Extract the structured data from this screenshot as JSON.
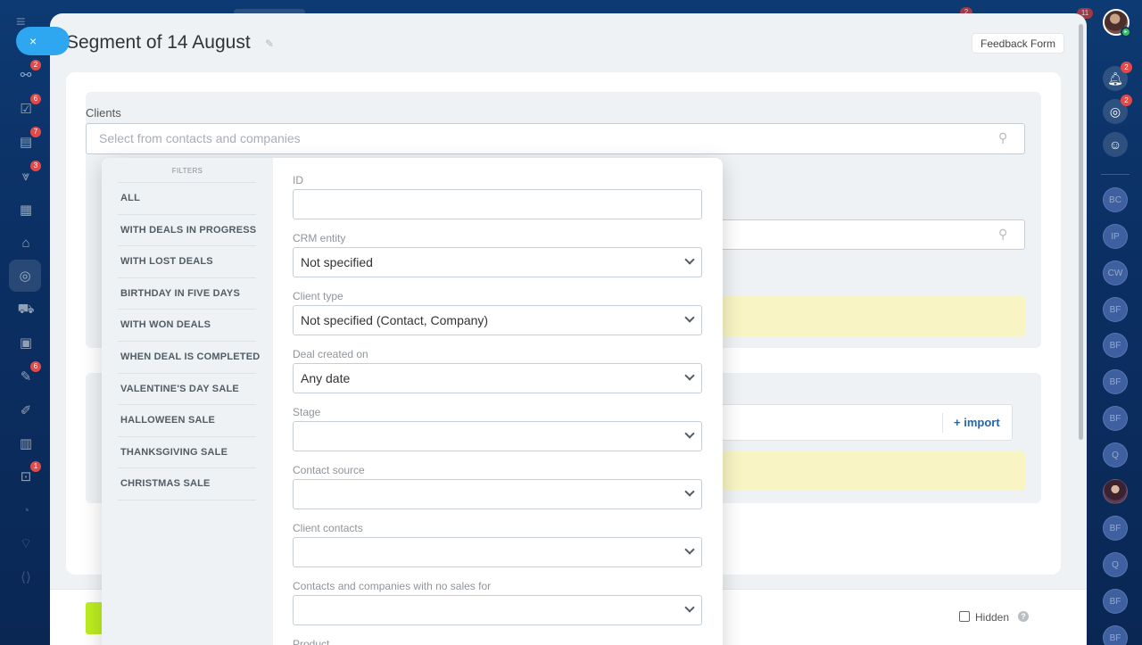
{
  "slider": {
    "title": "Segment of 14 August",
    "feedback_label": "Feedback Form"
  },
  "clients": {
    "label": "Clients",
    "placeholder": "Select from contacts and companies"
  },
  "import": {
    "label": "+ import"
  },
  "footer": {
    "hidden_label": "Hidden",
    "help_glyph": "?"
  },
  "close_glyph": "×",
  "filters": {
    "heading": "FILTERS",
    "items": [
      "ALL",
      "WITH DEALS IN PROGRESS",
      "WITH LOST DEALS",
      "BIRTHDAY IN FIVE DAYS",
      "WITH WON DEALS",
      "WHEN DEAL IS COMPLETED",
      "VALENTINE'S DAY SALE",
      "HALLOWEEN SALE",
      "THANKSGIVING SALE",
      "CHRISTMAS SALE"
    ]
  },
  "fields": [
    {
      "label": "ID",
      "value": "",
      "type": "text"
    },
    {
      "label": "CRM entity",
      "value": "Not specified",
      "type": "select"
    },
    {
      "label": "Client type",
      "value": "Not specified (Contact, Company)",
      "type": "select"
    },
    {
      "label": "Deal created on",
      "value": "Any date",
      "type": "select"
    },
    {
      "label": "Stage",
      "value": "",
      "type": "select"
    },
    {
      "label": "Contact source",
      "value": "",
      "type": "select"
    },
    {
      "label": "Client contacts",
      "value": "",
      "type": "select"
    },
    {
      "label": "Contacts and companies with no sales for",
      "value": "",
      "type": "select"
    },
    {
      "label": "Product",
      "value": "",
      "type": "select"
    }
  ],
  "left_rail": {
    "badges": [
      "2",
      "6",
      "7",
      "3",
      "6",
      "1"
    ]
  },
  "right_rail": {
    "notification_badge": "2",
    "target_badge": "2",
    "avatars": [
      "BC",
      "IP",
      "CW",
      "BF",
      "BF",
      "BF",
      "BF",
      "Q",
      "",
      "BF",
      "Q",
      "BF",
      "BF"
    ]
  },
  "top": {
    "badge_1": "2",
    "badge_2": "11"
  },
  "colors": {
    "accent_blue": "#2fa6f0",
    "save_green": "#bbed21",
    "warning_yellow": "#f8f4c4",
    "link_blue": "#2067b0",
    "badge_red": "#e24a4a"
  }
}
